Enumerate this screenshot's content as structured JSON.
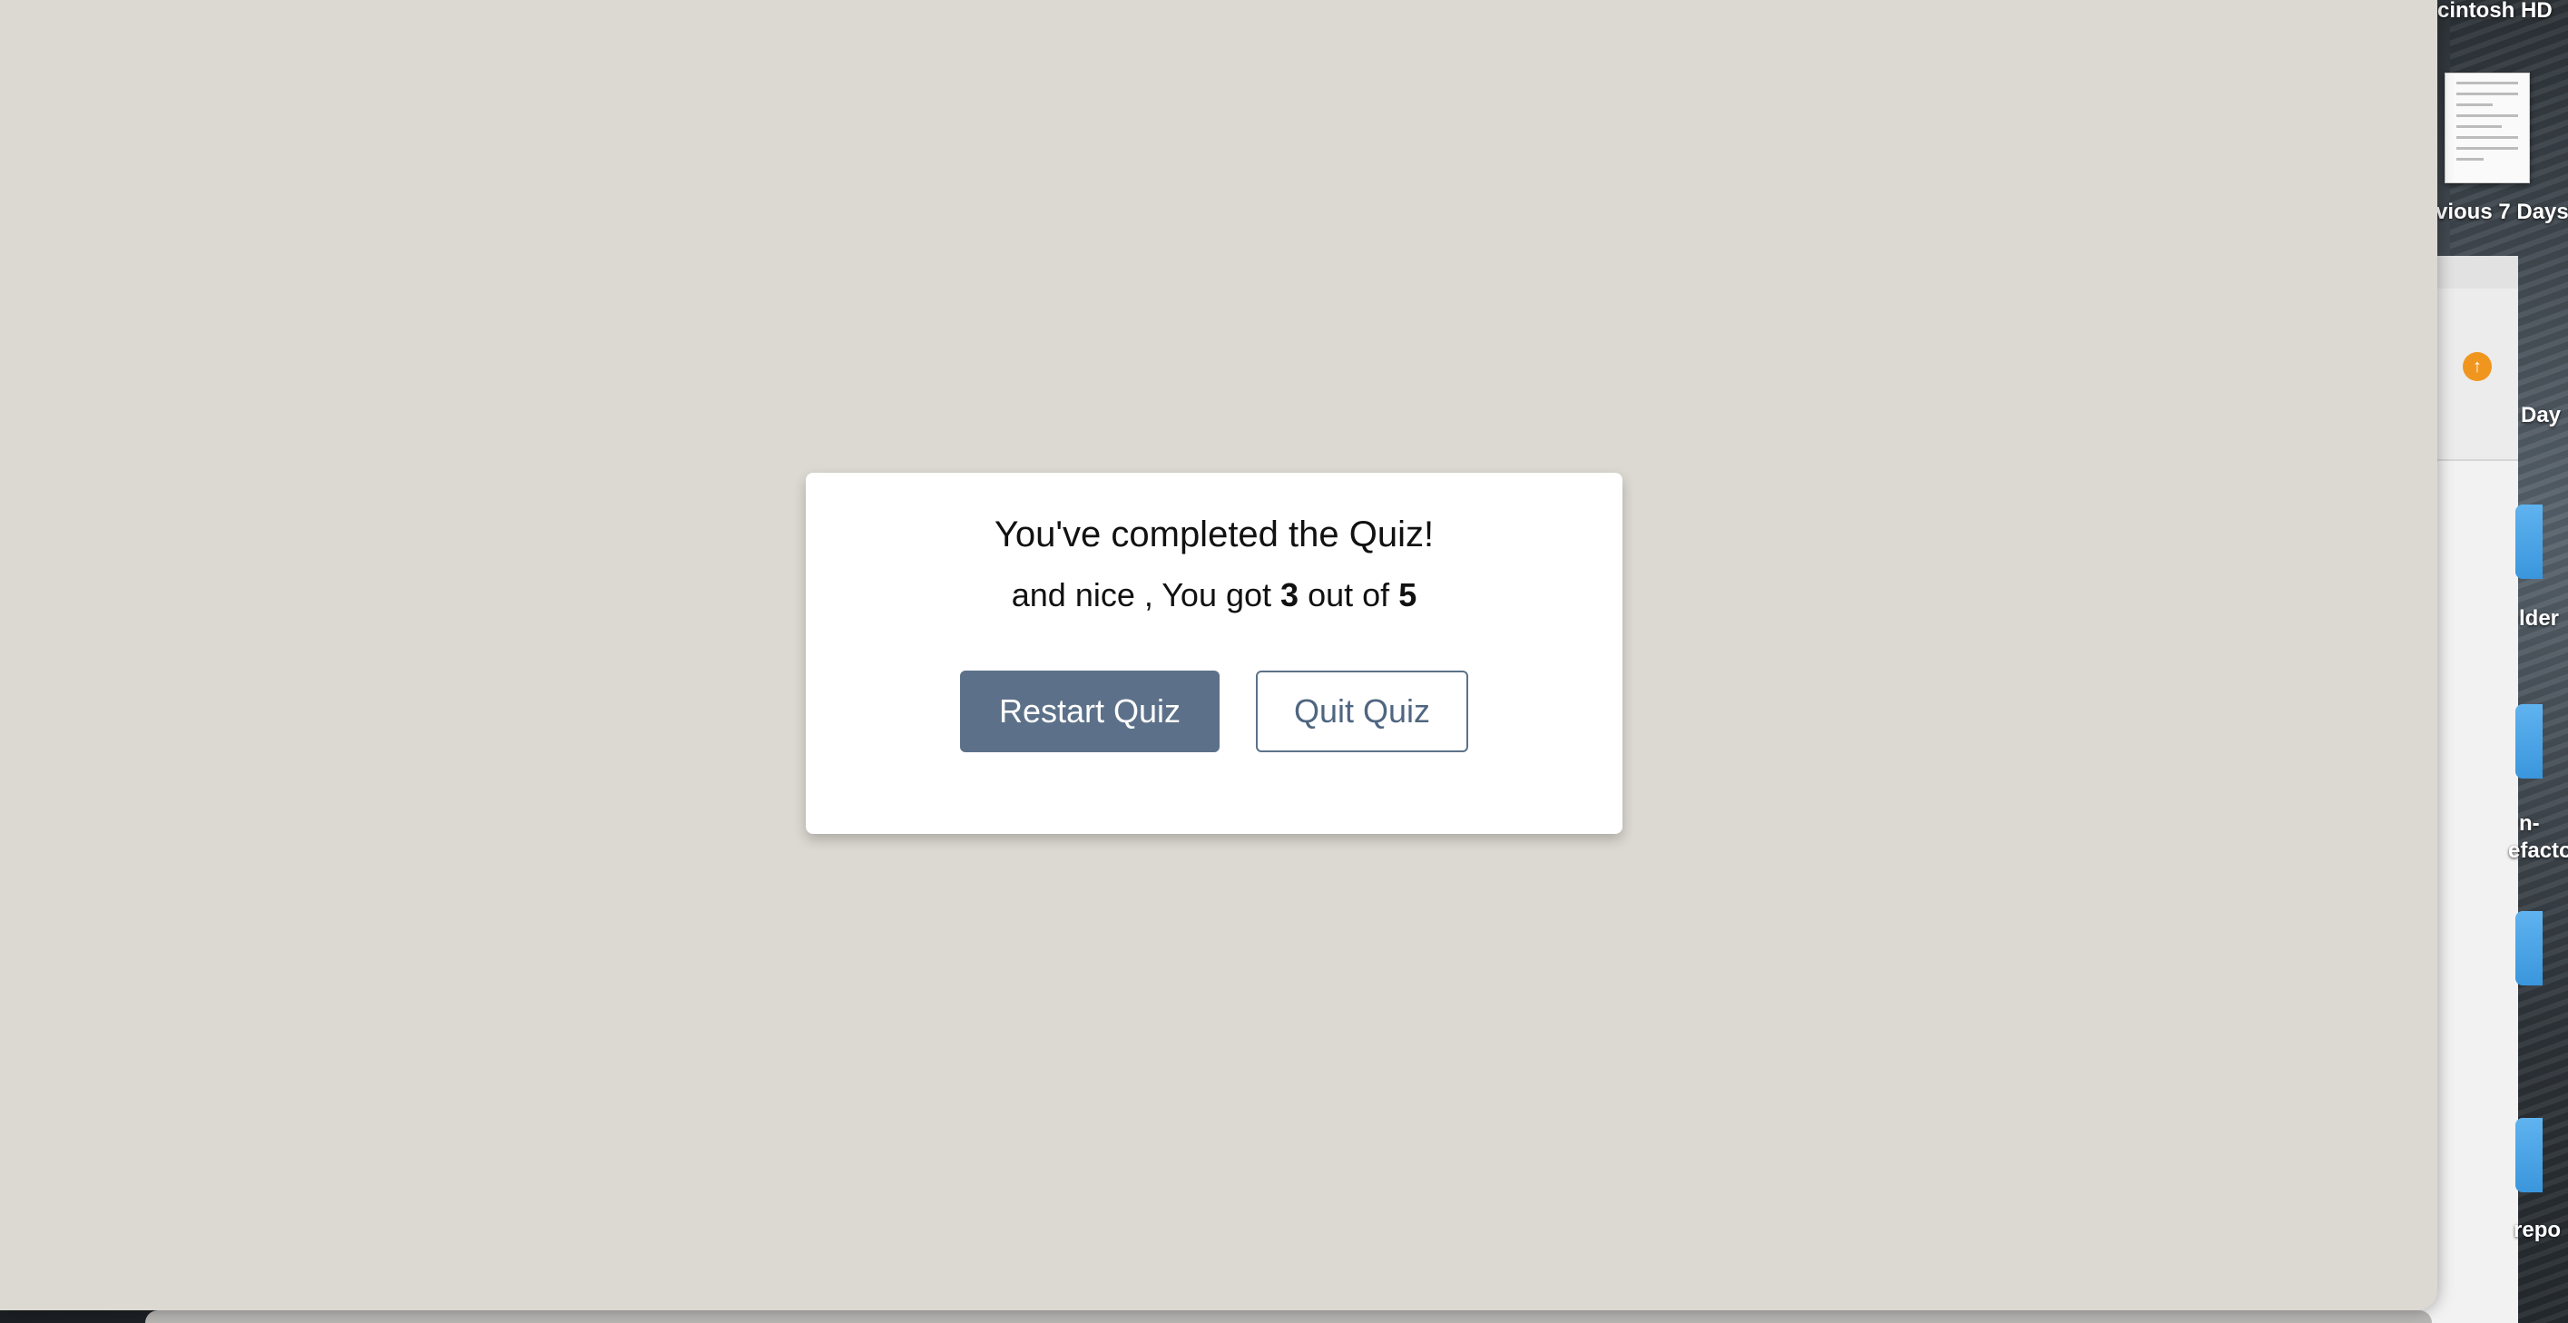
{
  "desktop": {
    "labels": [
      {
        "id": "hd",
        "text": "cintosh HD"
      },
      {
        "id": "prev7",
        "text": "vious 7 Days"
      },
      {
        "id": "day",
        "text": "Day"
      },
      {
        "id": "older",
        "text": "lder"
      },
      {
        "id": "ref1",
        "text": "n-"
      },
      {
        "id": "ref2",
        "text": "efacto"
      },
      {
        "id": "repo",
        "text": "repo"
      }
    ]
  },
  "quiz_result": {
    "title": "You've completed the Quiz!",
    "score_prefix": "and nice , You got",
    "score": "3",
    "score_middle": "out of",
    "total": "5",
    "restart_label": "Restart Quiz",
    "quit_label": "Quit Quiz"
  },
  "colors": {
    "page_background": "#dcd9d2",
    "primary_button": "#5c7189",
    "upload_badge": "#f0961f"
  },
  "icons": [
    "document-thumbnail-icon",
    "folder-icon",
    "upload-icon"
  ]
}
